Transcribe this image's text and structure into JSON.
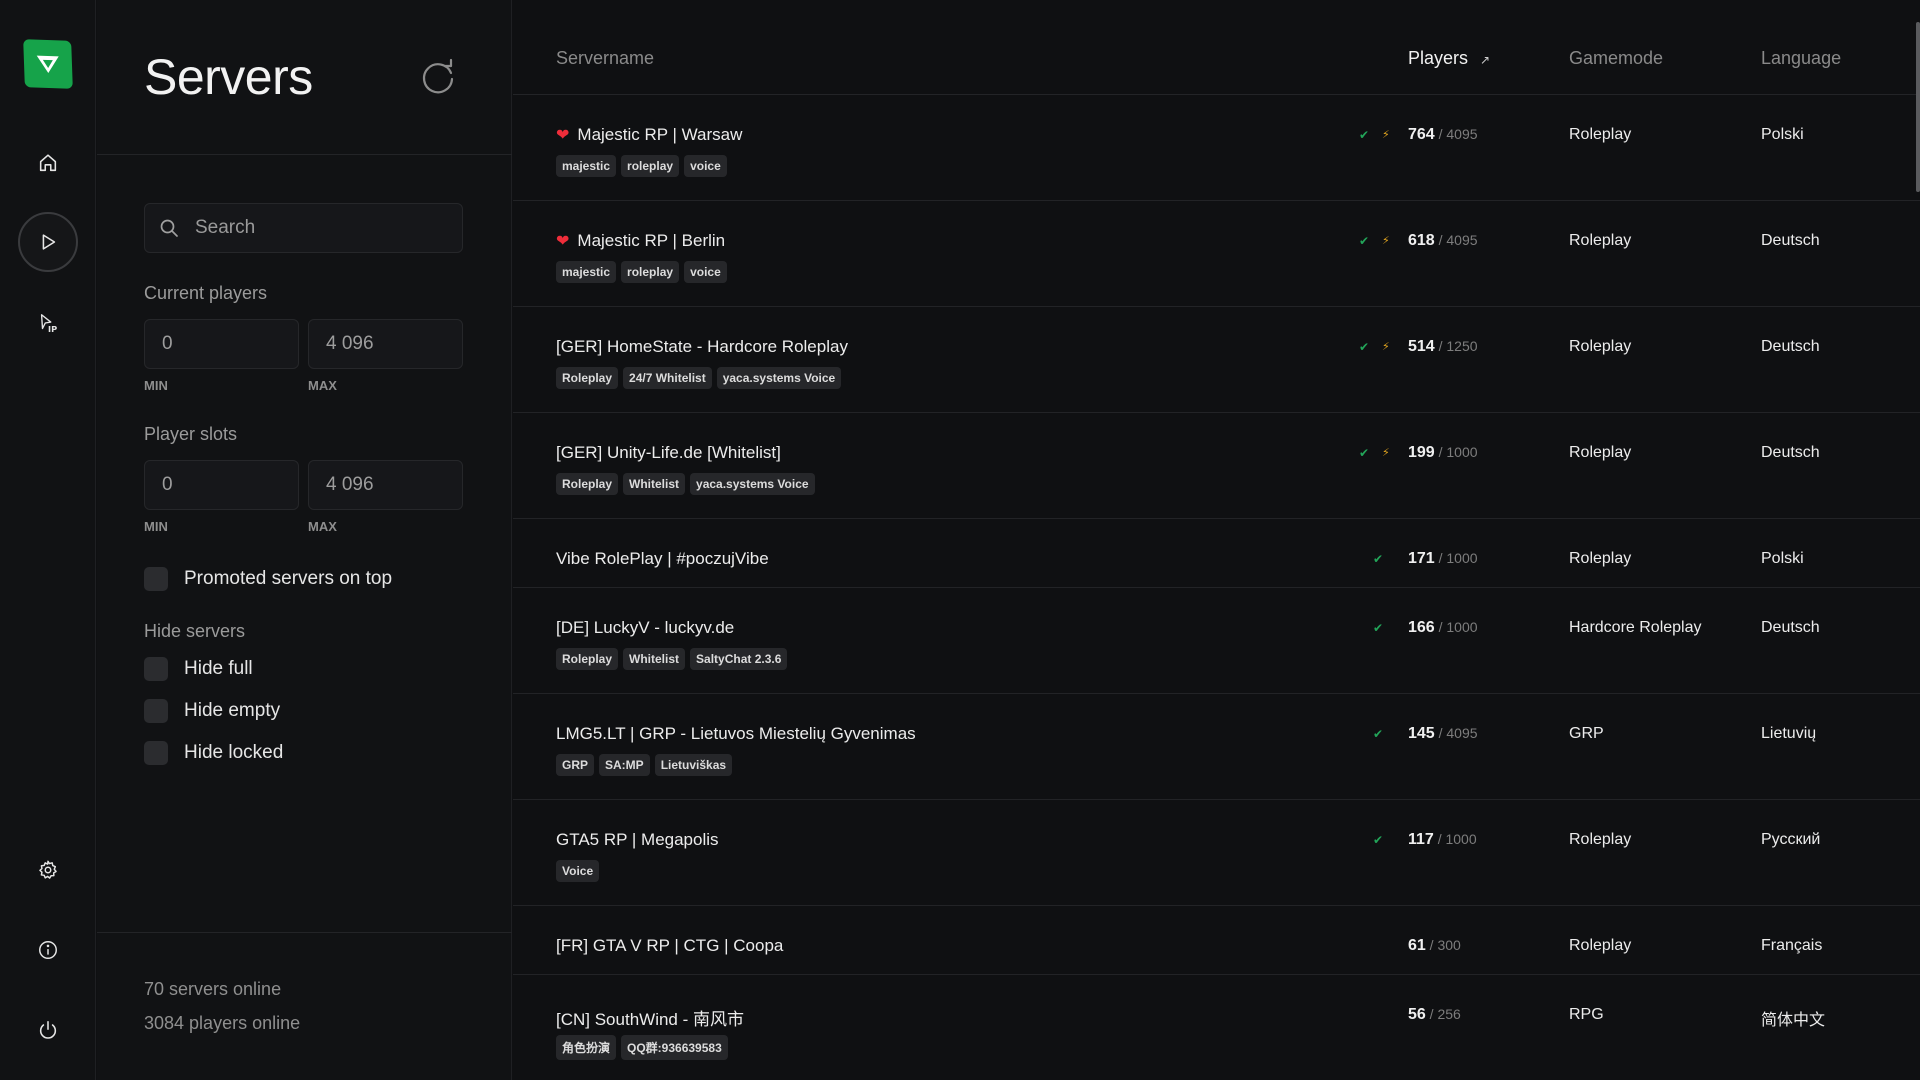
{
  "nav": {
    "logo": "v-logo",
    "items": [
      {
        "name": "home",
        "icon": "home-icon"
      },
      {
        "name": "servers",
        "icon": "play-icon",
        "active": true
      },
      {
        "name": "direct-connect",
        "icon": "ip-connect-icon"
      },
      {
        "name": "settings",
        "icon": "gear-icon"
      },
      {
        "name": "info",
        "icon": "info-icon"
      },
      {
        "name": "power",
        "icon": "power-icon"
      }
    ]
  },
  "filters": {
    "title": "Servers",
    "refresh_icon": "refresh-icon",
    "search_placeholder": "Search",
    "current_players": {
      "label": "Current players",
      "min": "0",
      "max": "4 096",
      "min_label": "MIN",
      "max_label": "MAX"
    },
    "player_slots": {
      "label": "Player slots",
      "min": "0",
      "max": "4 096",
      "min_label": "MIN",
      "max_label": "MAX"
    },
    "promoted_on_top": {
      "label": "Promoted servers on top",
      "checked": false
    },
    "hide_servers_label": "Hide servers",
    "hide_full": {
      "label": "Hide full",
      "checked": false
    },
    "hide_empty": {
      "label": "Hide empty",
      "checked": false
    },
    "hide_locked": {
      "label": "Hide locked",
      "checked": false
    },
    "servers_online": "70 servers online",
    "players_online": "3084 players online"
  },
  "table": {
    "headers": {
      "servername": "Servername",
      "players": "Players",
      "players_sort": "↗",
      "gamemode": "Gamemode",
      "language": "Language"
    },
    "colors": {
      "ok": "#22a559",
      "bolt": "#e0a420",
      "heart": "#ef2d3a"
    },
    "rows": [
      {
        "favorite": true,
        "name": "Majestic RP | Warsaw",
        "tags": [
          "majestic",
          "roleplay",
          "voice"
        ],
        "verified": true,
        "boosted": true,
        "players": "764",
        "max": "/ 4095",
        "gamemode": "Roleplay",
        "language": "Polski"
      },
      {
        "favorite": true,
        "name": "Majestic RP | Berlin",
        "tags": [
          "majestic",
          "roleplay",
          "voice"
        ],
        "verified": true,
        "boosted": true,
        "players": "618",
        "max": "/ 4095",
        "gamemode": "Roleplay",
        "language": "Deutsch"
      },
      {
        "favorite": false,
        "name": "[GER] HomeState - Hardcore Roleplay",
        "tags": [
          "Roleplay",
          "24/7 Whitelist",
          "yaca.systems Voice"
        ],
        "verified": true,
        "boosted": true,
        "players": "514",
        "max": "/ 1250",
        "gamemode": "Roleplay",
        "language": "Deutsch"
      },
      {
        "favorite": false,
        "name": "[GER] Unity-Life.de [Whitelist]",
        "tags": [
          "Roleplay",
          "Whitelist",
          "yaca.systems Voice"
        ],
        "verified": true,
        "boosted": true,
        "players": "199",
        "max": "/ 1000",
        "gamemode": "Roleplay",
        "language": "Deutsch"
      },
      {
        "favorite": false,
        "name": "Vibe RolePlay | #poczujVibe",
        "tags": [],
        "verified": true,
        "boosted": false,
        "players": "171",
        "max": "/ 1000",
        "gamemode": "Roleplay",
        "language": "Polski"
      },
      {
        "favorite": false,
        "name": "[DE] LuckyV - luckyv.de",
        "tags": [
          "Roleplay",
          "Whitelist",
          "SaltyChat 2.3.6"
        ],
        "verified": true,
        "boosted": false,
        "players": "166",
        "max": "/ 1000",
        "gamemode": "Hardcore Roleplay",
        "language": "Deutsch"
      },
      {
        "favorite": false,
        "name": "LMG5.LT | GRP - Lietuvos Miestelių Gyvenimas",
        "tags": [
          "GRP",
          "SA:MP",
          "Lietuviškas"
        ],
        "verified": true,
        "boosted": false,
        "players": "145",
        "max": "/ 4095",
        "gamemode": "GRP",
        "language": "Lietuvių"
      },
      {
        "favorite": false,
        "name": "GTA5 RP | Megapolis",
        "tags": [
          "Voice"
        ],
        "verified": true,
        "boosted": false,
        "players": "117",
        "max": "/ 1000",
        "gamemode": "Roleplay",
        "language": "Русский"
      },
      {
        "favorite": false,
        "name": "[FR] GTA V RP | CTG | Coopa",
        "tags": [],
        "verified": false,
        "boosted": false,
        "players": "61",
        "max": "/ 300",
        "gamemode": "Roleplay",
        "language": "Français"
      },
      {
        "favorite": false,
        "name": "[CN] SouthWind - 南风市",
        "tags": [
          "角色扮演",
          "QQ群:936639583"
        ],
        "verified": false,
        "boosted": false,
        "players": "56",
        "max": "/ 256",
        "gamemode": "RPG",
        "language": "简体中文"
      }
    ]
  }
}
